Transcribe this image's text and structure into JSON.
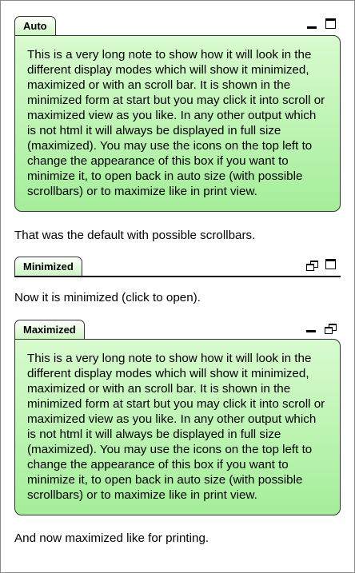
{
  "notes": [
    {
      "title": "Auto",
      "mode": "auto",
      "icons": [
        "minimize-icon",
        "maximize-icon"
      ],
      "body": "This is a very long note to show how it will look in the different display modes which will show it minimized, maximized or with an scroll bar. It is shown in the minimized form at start but you may click it into scroll or maximized view as you like. In any other output which is not html it will always be displayed in full size (maximized). You may use the icons on the top left to change the appearance of this box if you want to minimize it, to open back in auto size (with possible scrollbars) or to maximize like in print view.",
      "after_text": "That was the default with possible scrollbars."
    },
    {
      "title": "Minimized",
      "mode": "minimized",
      "icons": [
        "restore-icon",
        "maximize-icon"
      ],
      "body": "",
      "after_text": "Now it is minimized (click to open)."
    },
    {
      "title": "Maximized",
      "mode": "maximized",
      "icons": [
        "minimize-icon",
        "restore-icon"
      ],
      "body": "This is a very long note to show how it will look in the different display modes which will show it minimized, maximized or with an scroll bar. It is shown in the minimized form at start but you may click it into scroll or maximized view as you like. In any other output which is not html it will always be displayed in full size (maximized). You may use the icons on the top left to change the appearance of this box if you want to minimize it, to open back in auto size (with possible scrollbars) or to maximize like in print view.",
      "after_text": "And now maximized like for printing."
    }
  ],
  "colors": {
    "box_top": "#d8fbcf",
    "box_bottom": "#a4ee99",
    "border": "#333333"
  }
}
